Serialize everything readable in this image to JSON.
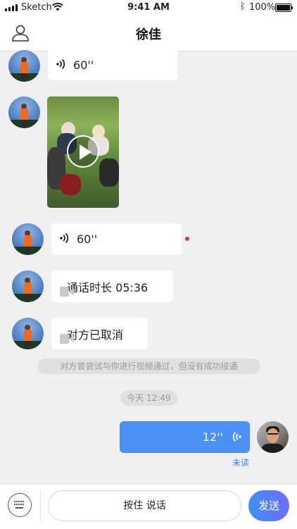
{
  "status_bar": {
    "carrier": "Sketch",
    "time": "9:41 AM",
    "battery": "100%"
  },
  "header": {
    "title": "徐佳"
  },
  "messages": {
    "voice1": "60''",
    "voice2": "60''",
    "call_duration": "通话时长 05:36",
    "call_cancelled": "对方已取消",
    "system_notice": "对方曾尝试与你进行视频通过，但没有成功接通",
    "timestamp": "今天 12:49",
    "sent_voice": "12''",
    "unread_label": "未读"
  },
  "input_bar": {
    "hold_to_talk": "按住 说话",
    "send_label": "发送"
  },
  "icons": {
    "profile": "person-outline-icon",
    "voice": "sound-wave-icon",
    "video": "video-camera-icon",
    "keyboard": "keyboard-icon",
    "play": "play-icon"
  },
  "colors": {
    "accent": "#4a90f5",
    "unread_dot": "#e23c3c",
    "send_gradient_end": "#6f6ff5"
  }
}
